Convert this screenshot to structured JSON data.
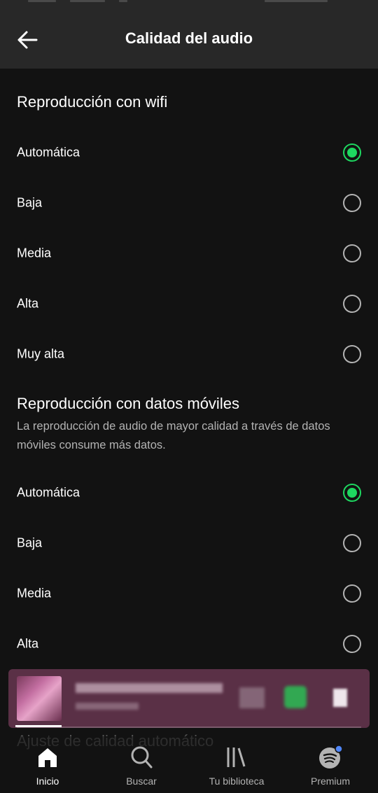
{
  "header": {
    "title": "Calidad del audio",
    "back_icon": "arrow-left-icon"
  },
  "wifi": {
    "title": "Reproducción con wifi",
    "options": [
      {
        "label": "Automática",
        "selected": true
      },
      {
        "label": "Baja",
        "selected": false
      },
      {
        "label": "Media",
        "selected": false
      },
      {
        "label": "Alta",
        "selected": false
      },
      {
        "label": "Muy alta",
        "selected": false
      }
    ]
  },
  "mobile": {
    "title": "Reproducción con datos móviles",
    "description": "La reproducción de audio de mayor calidad a través de datos móviles consume más datos.",
    "options": [
      {
        "label": "Automática",
        "selected": true
      },
      {
        "label": "Baja",
        "selected": false
      },
      {
        "label": "Media",
        "selected": false
      },
      {
        "label": "Alta",
        "selected": false
      }
    ]
  },
  "partially_hidden": {
    "title": "Ajuste de calidad automático"
  },
  "bottom_nav": [
    {
      "label": "Inicio",
      "icon": "home-icon",
      "active": true
    },
    {
      "label": "Buscar",
      "icon": "search-icon",
      "active": false
    },
    {
      "label": "Tu biblioteca",
      "icon": "library-icon",
      "active": false
    },
    {
      "label": "Premium",
      "icon": "spotify-logo-icon",
      "active": false
    }
  ],
  "colors": {
    "accent": "#1ed760",
    "background": "#121212",
    "header": "#282828",
    "miniplayer": "#5a3046"
  }
}
